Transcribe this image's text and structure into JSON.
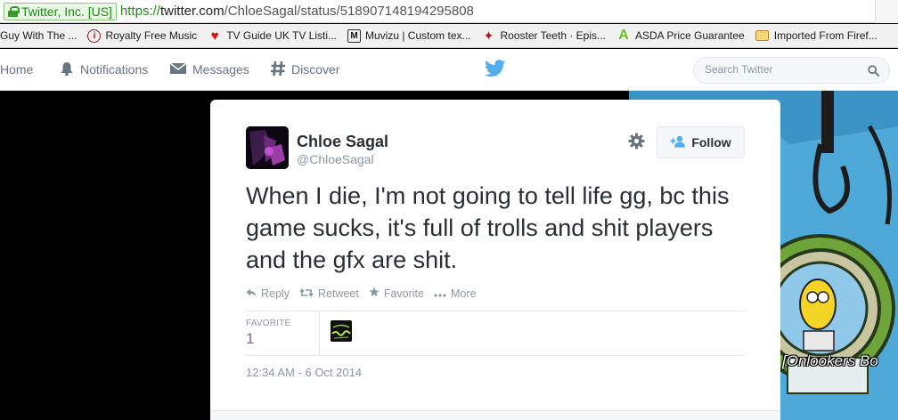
{
  "browser": {
    "cert_label": "Twitter, Inc. [US]",
    "url_scheme": "https://",
    "url_host": "twitter.com",
    "url_path": "/ChloeSagal/status/518907148194295808"
  },
  "bookmarks": [
    {
      "label": "Guy With The ...",
      "icon": "bookmark-icon"
    },
    {
      "label": "Royalty Free Music",
      "icon": "info-icon"
    },
    {
      "label": "TV Guide UK TV Listi...",
      "icon": "heart-icon"
    },
    {
      "label": "Muvizu | Custom tex...",
      "icon": "m-logo-icon"
    },
    {
      "label": "Rooster Teeth · Epis...",
      "icon": "rooster-icon"
    },
    {
      "label": "ASDA Price Guarantee",
      "icon": "a-logo-icon"
    },
    {
      "label": "Imported From Firef...",
      "icon": "folder-icon"
    }
  ],
  "nav": {
    "home": "Home",
    "notifications": "Notifications",
    "messages": "Messages",
    "discover": "Discover",
    "search_placeholder": "Search Twitter"
  },
  "tweet": {
    "fullname": "Chloe Sagal",
    "username": "@ChloeSagal",
    "follow_label": "Follow",
    "text": "When I die, I'm not going to tell life gg, bc this game sucks, it's full of trolls and shit players and the gfx are shit.",
    "actions": {
      "reply": "Reply",
      "retweet": "Retweet",
      "favorite": "Favorite",
      "more": "More"
    },
    "stats": {
      "favorite_label": "FAVORITE",
      "favorite_count": "1"
    },
    "timestamp": "12:34 AM - 6 Oct 2014"
  },
  "background": {
    "caption": "[Onlookers Bo"
  },
  "colors": {
    "twitter_blue": "#55acee",
    "link_purple": "#7e5fb5",
    "secure_green": "#1f8a17"
  }
}
